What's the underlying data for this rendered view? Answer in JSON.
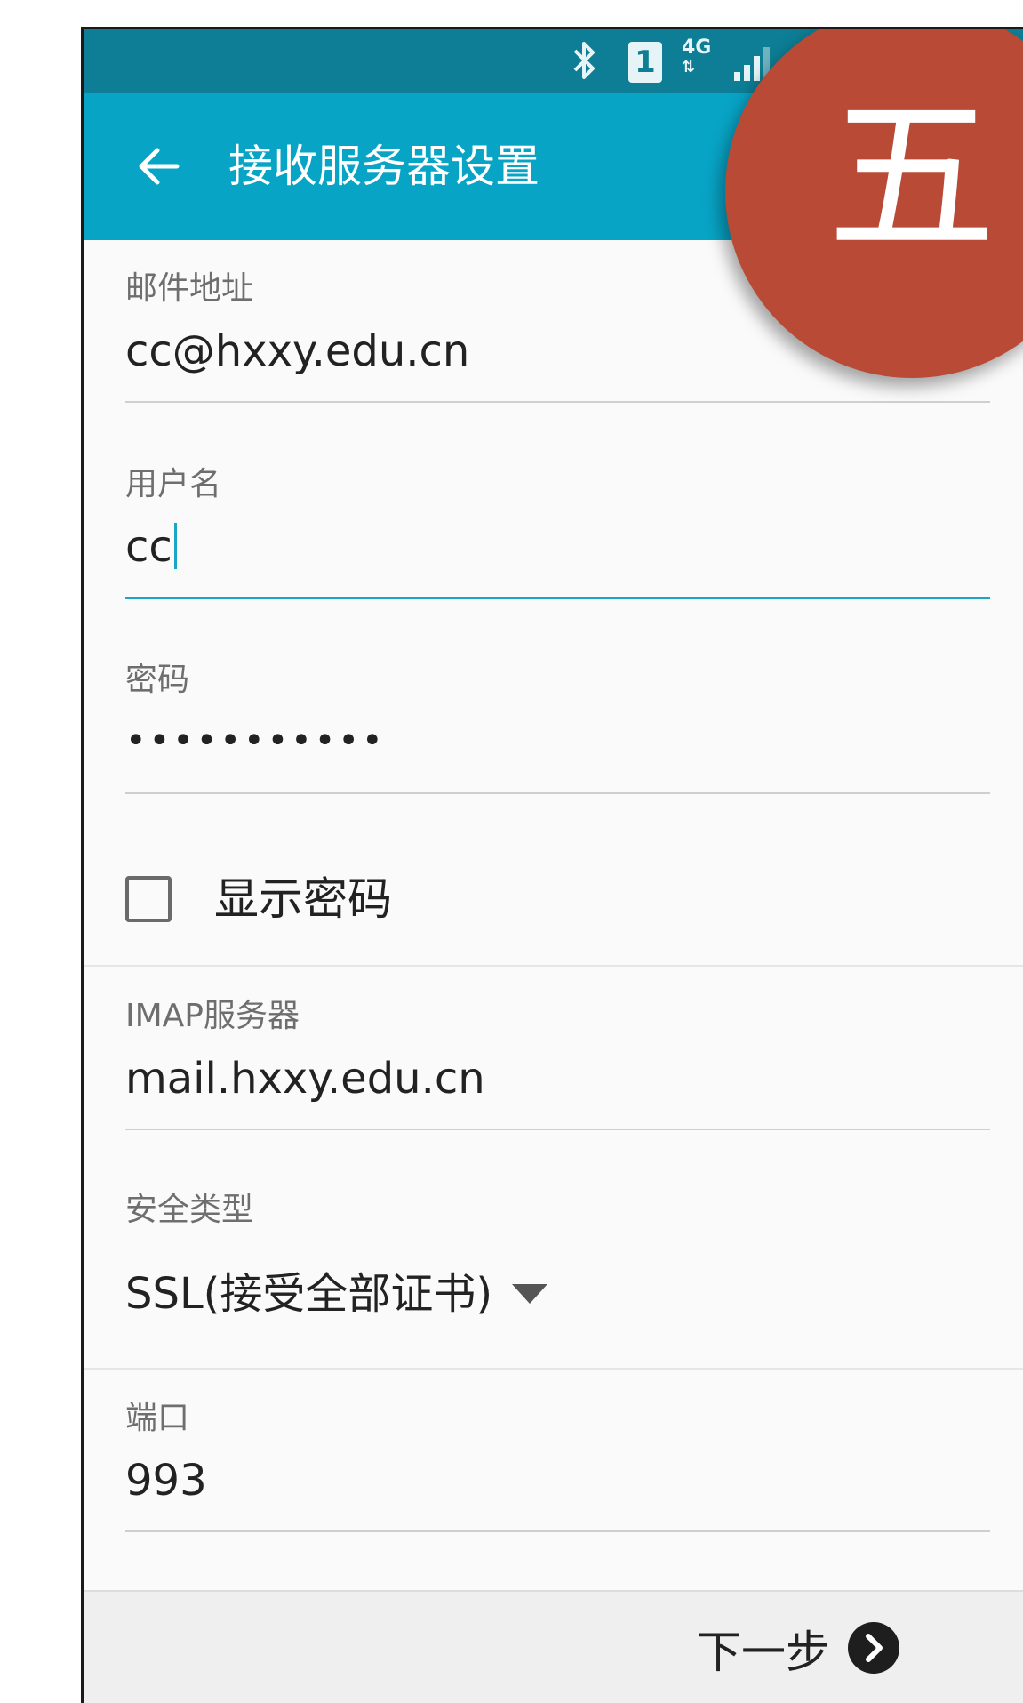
{
  "status_bar": {
    "sim_slot": "1",
    "network": "4G",
    "icons": [
      "bluetooth-icon",
      "sim-icon",
      "4g-data-icon",
      "signal-icon"
    ]
  },
  "app_bar": {
    "title": "接收服务器设置",
    "back_icon": "back-arrow-icon",
    "color": "#08a4c6"
  },
  "overlay_badge": {
    "text": "五",
    "color": "#b84a36"
  },
  "form": {
    "email": {
      "label": "邮件地址",
      "value": "cc@hxxy.edu.cn"
    },
    "username": {
      "label": "用户名",
      "value": "cc"
    },
    "password": {
      "label": "密码",
      "value": "•••••••••••"
    },
    "show_password": {
      "label": "显示密码",
      "checked": false
    },
    "imap_server": {
      "label": "IMAP服务器",
      "value": "mail.hxxy.edu.cn"
    },
    "security_type": {
      "label": "安全类型",
      "value": "SSL(接受全部证书)"
    },
    "port": {
      "label": "端口",
      "value": "993"
    }
  },
  "footer": {
    "next_label": "下一步",
    "next_icon": "chevron-right-circle-icon"
  },
  "colors": {
    "accent": "#1aa6c8",
    "status_bar": "#0d7e95"
  }
}
